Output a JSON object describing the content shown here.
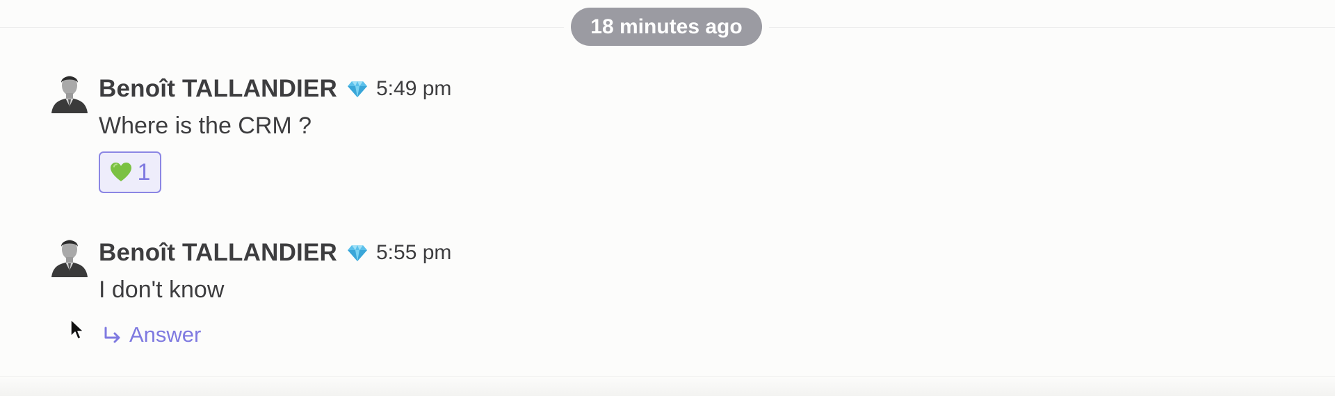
{
  "divider": {
    "label": "18 minutes ago"
  },
  "messages": [
    {
      "author": "Benoît TALLANDIER",
      "badge_icon": "diamond-icon",
      "time": "5:49 pm",
      "text": "Where is the CRM ?",
      "reaction": {
        "emoji_icon": "green-heart-icon",
        "count": "1"
      }
    },
    {
      "author": "Benoît TALLANDIER",
      "badge_icon": "diamond-icon",
      "time": "5:55 pm",
      "text": "I don't know",
      "answer_label": "Answer"
    }
  ],
  "colors": {
    "accent": "#7f7ae0",
    "pill": "#9b9ba2",
    "text": "#3d3d3f",
    "background": "#fcfcfb",
    "reaction_bg": "#eeedfb"
  }
}
